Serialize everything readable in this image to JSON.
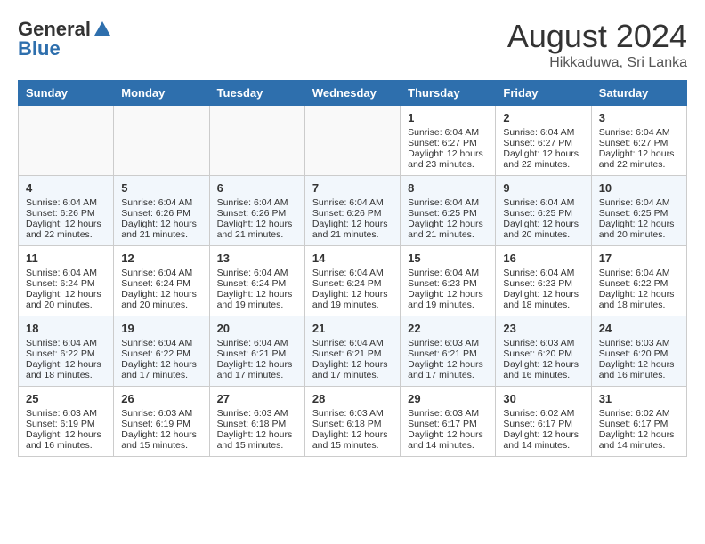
{
  "logo": {
    "general": "General",
    "blue": "Blue"
  },
  "title": "August 2024",
  "subtitle": "Hikkaduwa, Sri Lanka",
  "weekdays": [
    "Sunday",
    "Monday",
    "Tuesday",
    "Wednesday",
    "Thursday",
    "Friday",
    "Saturday"
  ],
  "weeks": [
    [
      {
        "day": "",
        "sunrise": "",
        "sunset": "",
        "daylight": ""
      },
      {
        "day": "",
        "sunrise": "",
        "sunset": "",
        "daylight": ""
      },
      {
        "day": "",
        "sunrise": "",
        "sunset": "",
        "daylight": ""
      },
      {
        "day": "",
        "sunrise": "",
        "sunset": "",
        "daylight": ""
      },
      {
        "day": "1",
        "sunrise": "Sunrise: 6:04 AM",
        "sunset": "Sunset: 6:27 PM",
        "daylight": "Daylight: 12 hours and 23 minutes."
      },
      {
        "day": "2",
        "sunrise": "Sunrise: 6:04 AM",
        "sunset": "Sunset: 6:27 PM",
        "daylight": "Daylight: 12 hours and 22 minutes."
      },
      {
        "day": "3",
        "sunrise": "Sunrise: 6:04 AM",
        "sunset": "Sunset: 6:27 PM",
        "daylight": "Daylight: 12 hours and 22 minutes."
      }
    ],
    [
      {
        "day": "4",
        "sunrise": "Sunrise: 6:04 AM",
        "sunset": "Sunset: 6:26 PM",
        "daylight": "Daylight: 12 hours and 22 minutes."
      },
      {
        "day": "5",
        "sunrise": "Sunrise: 6:04 AM",
        "sunset": "Sunset: 6:26 PM",
        "daylight": "Daylight: 12 hours and 21 minutes."
      },
      {
        "day": "6",
        "sunrise": "Sunrise: 6:04 AM",
        "sunset": "Sunset: 6:26 PM",
        "daylight": "Daylight: 12 hours and 21 minutes."
      },
      {
        "day": "7",
        "sunrise": "Sunrise: 6:04 AM",
        "sunset": "Sunset: 6:26 PM",
        "daylight": "Daylight: 12 hours and 21 minutes."
      },
      {
        "day": "8",
        "sunrise": "Sunrise: 6:04 AM",
        "sunset": "Sunset: 6:25 PM",
        "daylight": "Daylight: 12 hours and 21 minutes."
      },
      {
        "day": "9",
        "sunrise": "Sunrise: 6:04 AM",
        "sunset": "Sunset: 6:25 PM",
        "daylight": "Daylight: 12 hours and 20 minutes."
      },
      {
        "day": "10",
        "sunrise": "Sunrise: 6:04 AM",
        "sunset": "Sunset: 6:25 PM",
        "daylight": "Daylight: 12 hours and 20 minutes."
      }
    ],
    [
      {
        "day": "11",
        "sunrise": "Sunrise: 6:04 AM",
        "sunset": "Sunset: 6:24 PM",
        "daylight": "Daylight: 12 hours and 20 minutes."
      },
      {
        "day": "12",
        "sunrise": "Sunrise: 6:04 AM",
        "sunset": "Sunset: 6:24 PM",
        "daylight": "Daylight: 12 hours and 20 minutes."
      },
      {
        "day": "13",
        "sunrise": "Sunrise: 6:04 AM",
        "sunset": "Sunset: 6:24 PM",
        "daylight": "Daylight: 12 hours and 19 minutes."
      },
      {
        "day": "14",
        "sunrise": "Sunrise: 6:04 AM",
        "sunset": "Sunset: 6:24 PM",
        "daylight": "Daylight: 12 hours and 19 minutes."
      },
      {
        "day": "15",
        "sunrise": "Sunrise: 6:04 AM",
        "sunset": "Sunset: 6:23 PM",
        "daylight": "Daylight: 12 hours and 19 minutes."
      },
      {
        "day": "16",
        "sunrise": "Sunrise: 6:04 AM",
        "sunset": "Sunset: 6:23 PM",
        "daylight": "Daylight: 12 hours and 18 minutes."
      },
      {
        "day": "17",
        "sunrise": "Sunrise: 6:04 AM",
        "sunset": "Sunset: 6:22 PM",
        "daylight": "Daylight: 12 hours and 18 minutes."
      }
    ],
    [
      {
        "day": "18",
        "sunrise": "Sunrise: 6:04 AM",
        "sunset": "Sunset: 6:22 PM",
        "daylight": "Daylight: 12 hours and 18 minutes."
      },
      {
        "day": "19",
        "sunrise": "Sunrise: 6:04 AM",
        "sunset": "Sunset: 6:22 PM",
        "daylight": "Daylight: 12 hours and 17 minutes."
      },
      {
        "day": "20",
        "sunrise": "Sunrise: 6:04 AM",
        "sunset": "Sunset: 6:21 PM",
        "daylight": "Daylight: 12 hours and 17 minutes."
      },
      {
        "day": "21",
        "sunrise": "Sunrise: 6:04 AM",
        "sunset": "Sunset: 6:21 PM",
        "daylight": "Daylight: 12 hours and 17 minutes."
      },
      {
        "day": "22",
        "sunrise": "Sunrise: 6:03 AM",
        "sunset": "Sunset: 6:21 PM",
        "daylight": "Daylight: 12 hours and 17 minutes."
      },
      {
        "day": "23",
        "sunrise": "Sunrise: 6:03 AM",
        "sunset": "Sunset: 6:20 PM",
        "daylight": "Daylight: 12 hours and 16 minutes."
      },
      {
        "day": "24",
        "sunrise": "Sunrise: 6:03 AM",
        "sunset": "Sunset: 6:20 PM",
        "daylight": "Daylight: 12 hours and 16 minutes."
      }
    ],
    [
      {
        "day": "25",
        "sunrise": "Sunrise: 6:03 AM",
        "sunset": "Sunset: 6:19 PM",
        "daylight": "Daylight: 12 hours and 16 minutes."
      },
      {
        "day": "26",
        "sunrise": "Sunrise: 6:03 AM",
        "sunset": "Sunset: 6:19 PM",
        "daylight": "Daylight: 12 hours and 15 minutes."
      },
      {
        "day": "27",
        "sunrise": "Sunrise: 6:03 AM",
        "sunset": "Sunset: 6:18 PM",
        "daylight": "Daylight: 12 hours and 15 minutes."
      },
      {
        "day": "28",
        "sunrise": "Sunrise: 6:03 AM",
        "sunset": "Sunset: 6:18 PM",
        "daylight": "Daylight: 12 hours and 15 minutes."
      },
      {
        "day": "29",
        "sunrise": "Sunrise: 6:03 AM",
        "sunset": "Sunset: 6:17 PM",
        "daylight": "Daylight: 12 hours and 14 minutes."
      },
      {
        "day": "30",
        "sunrise": "Sunrise: 6:02 AM",
        "sunset": "Sunset: 6:17 PM",
        "daylight": "Daylight: 12 hours and 14 minutes."
      },
      {
        "day": "31",
        "sunrise": "Sunrise: 6:02 AM",
        "sunset": "Sunset: 6:17 PM",
        "daylight": "Daylight: 12 hours and 14 minutes."
      }
    ]
  ]
}
